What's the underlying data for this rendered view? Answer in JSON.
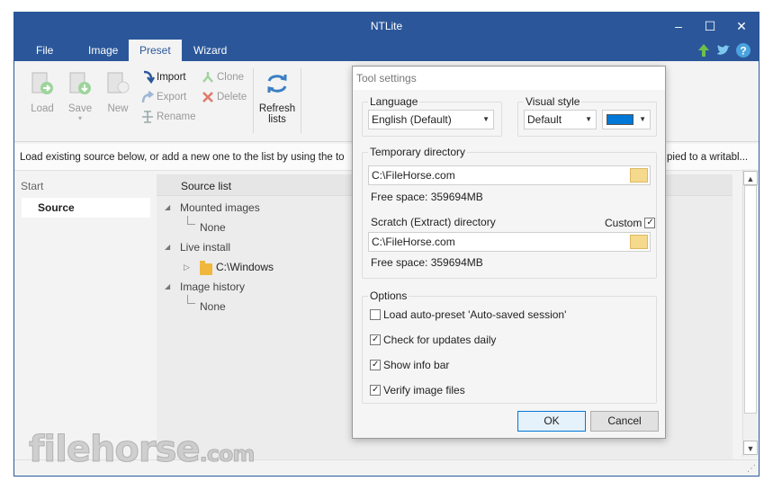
{
  "window": {
    "title": "NTLite"
  },
  "menu": {
    "tabs": [
      "File",
      "Image",
      "Preset",
      "Wizard"
    ]
  },
  "ribbon": {
    "load": "Load",
    "save": "Save",
    "new": "New",
    "import": "Import",
    "export": "Export",
    "rename": "Rename",
    "clone": "Clone",
    "delete": "Delete",
    "refresh_line1": "Refresh",
    "refresh_line2": "lists"
  },
  "infobar": {
    "text": "Load existing source below, or add a new one to the list by using the to",
    "tail": "pied to a writabl..."
  },
  "left_pane": {
    "header": "Start",
    "item": "Source"
  },
  "tree": {
    "header": "Source list",
    "mounted": "Mounted images",
    "mounted_child": "None",
    "live": "Live install",
    "live_child": "C:\\Windows",
    "history": "Image history",
    "history_child": "None"
  },
  "dialog": {
    "title": "Tool settings",
    "language_label": "Language",
    "language_value": "English (Default)",
    "visual_label": "Visual style",
    "visual_value": "Default",
    "accent_color": "#0078d7",
    "temp_label": "Temporary directory",
    "temp_path": "C:\\FileHorse.com",
    "temp_free": "Free space: 359694MB",
    "scratch_label": "Scratch (Extract) directory",
    "custom_label": "Custom",
    "scratch_path": "C:\\FileHorse.com",
    "scratch_free": "Free space: 359694MB",
    "options_label": "Options",
    "options": [
      {
        "label": "Load auto-preset 'Auto-saved session'",
        "checked": false
      },
      {
        "label": "Check for updates daily",
        "checked": true
      },
      {
        "label": "Show info bar",
        "checked": true
      },
      {
        "label": "Verify image files",
        "checked": true
      }
    ],
    "ok": "OK",
    "cancel": "Cancel"
  },
  "watermark": {
    "brand": "filehorse",
    "suffix": ".com"
  },
  "colors": {
    "titlebar": "#2b579a",
    "accent": "#0078d7"
  }
}
